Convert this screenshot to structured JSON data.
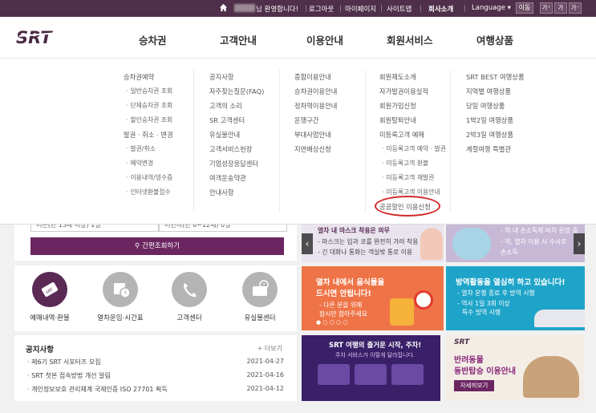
{
  "topbar": {
    "welcome": "님 환영합니다!",
    "logout": "로그아웃",
    "mypage": "마이페이지",
    "sitemap": "사이트맵",
    "company": "회사소개",
    "language": "Language ▾",
    "go": "이동",
    "font_up": "가⁺",
    "font_mid": "가",
    "font_down": "가⁻"
  },
  "logo": "SRT",
  "gnb": [
    "승차권",
    "고객안내",
    "이용안내",
    "회원서비스",
    "여행상품"
  ],
  "menu": {
    "col1": [
      {
        "t": "승차권예약",
        "sub": false
      },
      {
        "t": "일반승차권 조회",
        "sub": true
      },
      {
        "t": "단체승차권 조회",
        "sub": true
      },
      {
        "t": "할인승차권 조회",
        "sub": true
      },
      {
        "t": "발권 · 취소 · 변경",
        "sub": false
      },
      {
        "t": "발권/취소",
        "sub": true
      },
      {
        "t": "예약변경",
        "sub": true
      },
      {
        "t": "이용내역/영수증",
        "sub": true
      },
      {
        "t": "인터넷환불접수",
        "sub": true
      }
    ],
    "col2": [
      {
        "t": "공지사항",
        "sub": false
      },
      {
        "t": "자주찾는질문(FAQ)",
        "sub": false
      },
      {
        "t": "고객의 소리",
        "sub": false
      },
      {
        "t": "SR 고객센터",
        "sub": false
      },
      {
        "t": "유실물안내",
        "sub": false
      },
      {
        "t": "고객서비스헌장",
        "sub": false
      },
      {
        "t": "기업성장응답센터",
        "sub": false
      },
      {
        "t": "여객운송약관",
        "sub": false
      },
      {
        "t": "안내사항",
        "sub": false
      }
    ],
    "col3": [
      {
        "t": "종합이용안내",
        "sub": false
      },
      {
        "t": "승차권이용안내",
        "sub": false
      },
      {
        "t": "정차역이용안내",
        "sub": false
      },
      {
        "t": "운행구간",
        "sub": false
      },
      {
        "t": "부대사업안내",
        "sub": false
      },
      {
        "t": "지연배상신청",
        "sub": false
      }
    ],
    "col4": [
      {
        "t": "회원제도소개",
        "sub": false
      },
      {
        "t": "자가발권이용실적",
        "sub": false
      },
      {
        "t": "회원가입신청",
        "sub": false
      },
      {
        "t": "회원탈퇴안내",
        "sub": false
      },
      {
        "t": "미등록고객 예매",
        "sub": false
      },
      {
        "t": "미등록고객 예약 · 발권",
        "sub": true
      },
      {
        "t": "미등록고객 환불",
        "sub": true
      },
      {
        "t": "미등록고객 재발권",
        "sub": true
      },
      {
        "t": "미등록고객 이용안내",
        "sub": true
      },
      {
        "t": "공공할인 이용신청",
        "sub": false
      }
    ],
    "col5": [
      {
        "t": "SRT BEST 여행상품",
        "sub": false
      },
      {
        "t": "지역별 여행상품",
        "sub": false
      },
      {
        "t": "당일 여행상품",
        "sub": false
      },
      {
        "t": "1박2일 여행상품",
        "sub": false
      },
      {
        "t": "2박3일 여행상품",
        "sub": false
      },
      {
        "t": "계절여행 특별관",
        "sub": false
      }
    ]
  },
  "booking": {
    "sel1": "어른(만 13세 이상) 1명",
    "sel2": "어린이(만 6~12세) 0명",
    "search": "간편조회하기"
  },
  "quick": [
    {
      "label": "예매내역·환불",
      "icon": "ticket-icon",
      "color": "#5a2a55"
    },
    {
      "label": "열차운임·시간표",
      "icon": "timetable-icon",
      "color": "#b4b4b4"
    },
    {
      "label": "고객센터",
      "icon": "phone-icon",
      "color": "#b4b4b4"
    },
    {
      "label": "유실물센터",
      "icon": "lost-item-icon",
      "color": "#b4b4b4"
    }
  ],
  "notice": {
    "title": "공지사항",
    "more": "+ 더보기",
    "items": [
      {
        "t": "제6기 SRT 서포터즈 모집",
        "d": "2021-04-27"
      },
      {
        "t": "SRT 첫본 접속방법 개선 알림",
        "d": "2021-04-16"
      },
      {
        "t": "개인정보보호 관리체계 국제인증 ISO 27701 획득",
        "d": "2021-04-12"
      }
    ]
  },
  "banners": {
    "b1": [
      "열차 내 마스크 착용은 의무",
      "- 마스크는 입과 코를 완전히 가려 착용",
      "- 긴 대화나 통화는 객실밖 통로 이용"
    ],
    "b2": [
      "- 역 내 손소독제 비치 운영 중",
      "- 역, 열차 이용 시 수시로",
      "손소독"
    ],
    "b3": [
      "열차 내에서 음식물을",
      "드시면 안됩니다!",
      "- 다른 분을 위해",
      "잠시만 참아주세요"
    ],
    "b4": [
      "방역활동을 열심히 하고 있습니다!",
      "- 열차 운행 종료 후 방역 시행",
      "- 역사 1일 3회 이상",
      "특수 방역 시행"
    ],
    "b5": [
      "SRT 여행의 즐거운 시작, 주차!",
      "주차 서비스가 이렇게 달라집니다."
    ],
    "b6": [
      "반려동물",
      "동반탑승 이용안내",
      "자세히보기"
    ]
  },
  "colors": {
    "brand": "#4f2f49",
    "accent": "#6b2661",
    "highlight_circle": "#d42a2a"
  }
}
